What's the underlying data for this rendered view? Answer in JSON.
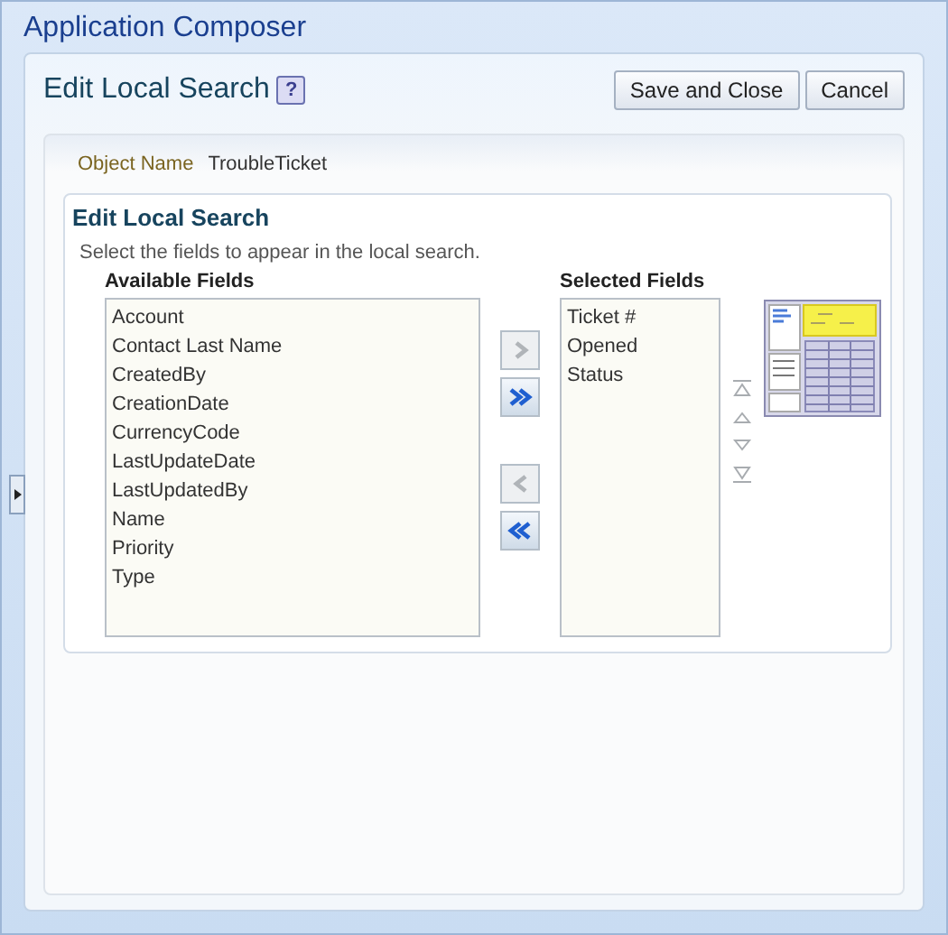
{
  "app_title": "Application Composer",
  "page": {
    "title": "Edit Local Search",
    "help_label": "?",
    "buttons": [
      "Save and Close",
      "Cancel"
    ]
  },
  "object_name": {
    "label": "Object Name",
    "value": "TroubleTicket"
  },
  "section": {
    "title": "Edit Local Search",
    "instructions": "Select the fields to appear in the local search.",
    "available": {
      "heading": "Available Fields",
      "items": [
        "Account",
        "Contact Last Name",
        "CreatedBy",
        "CreationDate",
        "CurrencyCode",
        "LastUpdateDate",
        "LastUpdatedBy",
        "Name",
        "Priority",
        "Type"
      ]
    },
    "shuttle_buttons": [
      {
        "kind": "move",
        "disabled": true
      },
      {
        "kind": "move_all",
        "disabled": false
      },
      {
        "kind": "remove",
        "disabled": true
      },
      {
        "kind": "remove_all",
        "disabled": false
      }
    ],
    "selected": {
      "heading": "Selected Fields",
      "items": [
        "Ticket #",
        "Opened",
        "Status"
      ]
    },
    "reorder_buttons": [
      {
        "kind": "top",
        "disabled": true
      },
      {
        "kind": "up",
        "disabled": true
      },
      {
        "kind": "down",
        "disabled": true
      },
      {
        "kind": "bottom",
        "disabled": true
      }
    ]
  }
}
